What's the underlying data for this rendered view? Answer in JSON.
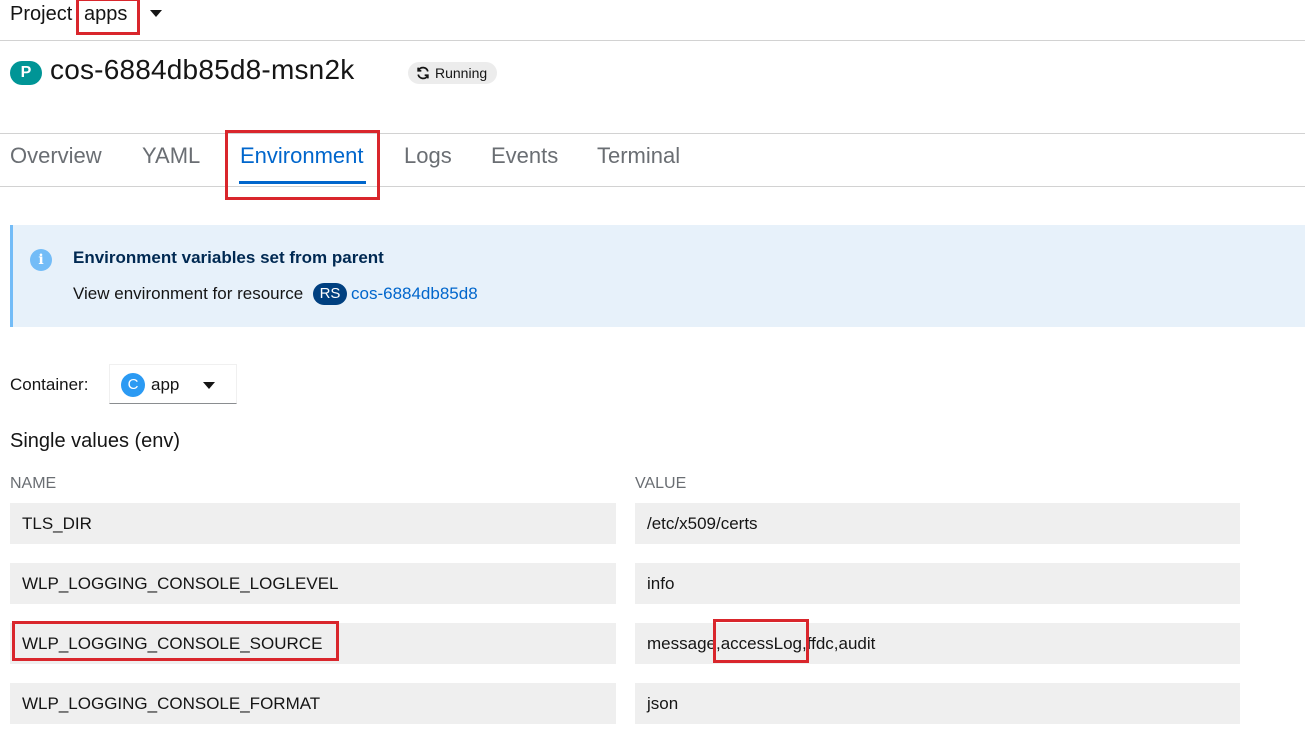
{
  "project": {
    "label": "Project",
    "value": "apps"
  },
  "pod": {
    "badge": "P",
    "name": "cos-6884db85d8-msn2k",
    "status": "Running"
  },
  "tabs": [
    {
      "label": "Overview"
    },
    {
      "label": "YAML"
    },
    {
      "label": "Environment",
      "active": true
    },
    {
      "label": "Logs"
    },
    {
      "label": "Events"
    },
    {
      "label": "Terminal"
    }
  ],
  "alert": {
    "title": "Environment variables set from parent",
    "body": "View environment for resource",
    "resource_badge": "RS",
    "resource_link": "cos-6884db85d8"
  },
  "container": {
    "label": "Container:",
    "badge": "C",
    "value": "app"
  },
  "section": {
    "title": "Single values (env)"
  },
  "table": {
    "headers": {
      "name": "NAME",
      "value": "VALUE"
    },
    "rows": [
      {
        "name": "TLS_DIR",
        "value": "/etc/x509/certs"
      },
      {
        "name": "WLP_LOGGING_CONSOLE_LOGLEVEL",
        "value": "info"
      },
      {
        "name": "WLP_LOGGING_CONSOLE_SOURCE",
        "value": "message,accessLog,ffdc,audit"
      },
      {
        "name": "WLP_LOGGING_CONSOLE_FORMAT",
        "value": "json"
      }
    ]
  },
  "colors": {
    "accent": "#0066cc",
    "pod_badge": "#009596",
    "info": "#73bcf7",
    "rs_badge": "#004080",
    "container_badge": "#2b9af3",
    "highlight": "#d9262c"
  },
  "icons": {
    "status": "sync-icon",
    "alert": "info-circle-icon",
    "dropdown": "caret-down-icon"
  }
}
